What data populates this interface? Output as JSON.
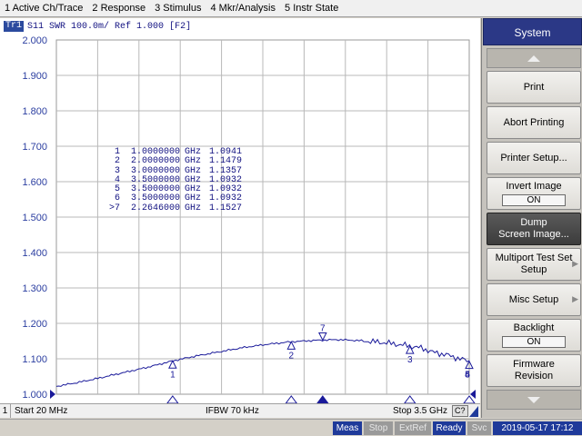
{
  "menubar": {
    "items": [
      "1 Active Ch/Trace",
      "2 Response",
      "3 Stimulus",
      "4 Mkr/Analysis",
      "5 Instr State"
    ]
  },
  "trace_header": {
    "badge": "Tr1",
    "param": "S11",
    "format": "SWR 100.0m/ Ref 1.000",
    "tag": "[F2]"
  },
  "chart_data": {
    "type": "line",
    "xlim": [
      0.02,
      3.5
    ],
    "ylim": [
      1.0,
      2.0
    ],
    "yticks": [
      "2.000",
      "1.900",
      "1.800",
      "1.700",
      "1.600",
      "1.500",
      "1.400",
      "1.300",
      "1.200",
      "1.100",
      "1.000"
    ],
    "grid": true,
    "series": [
      {
        "x": [
          0.02,
          0.2,
          0.4,
          0.6,
          0.8,
          1.0,
          1.2,
          1.4,
          1.6,
          1.8,
          2.0,
          2.2,
          2.4,
          2.6,
          2.8,
          3.0,
          3.1,
          3.2,
          3.3,
          3.4,
          3.5
        ],
        "y": [
          1.022,
          1.033,
          1.047,
          1.062,
          1.077,
          1.094,
          1.108,
          1.12,
          1.132,
          1.141,
          1.148,
          1.152,
          1.154,
          1.151,
          1.145,
          1.136,
          1.13,
          1.118,
          1.112,
          1.102,
          1.093
        ],
        "color": "#1a1a9a"
      }
    ],
    "markers": [
      {
        "label": "1",
        "num": "1",
        "freq": "1.0000000",
        "unit": "GHz",
        "value": "1.0941",
        "x": 1.0,
        "y": 1.0941
      },
      {
        "label": "2",
        "num": "2",
        "freq": "2.0000000",
        "unit": "GHz",
        "value": "1.1479",
        "x": 2.0,
        "y": 1.1479
      },
      {
        "label": "3",
        "num": "3",
        "freq": "3.0000000",
        "unit": "GHz",
        "value": "1.1357",
        "x": 3.0,
        "y": 1.1357
      },
      {
        "label": "4",
        "num": "4",
        "freq": "3.5000000",
        "unit": "GHz",
        "value": "1.0932",
        "x": 3.5,
        "y": 1.0932
      },
      {
        "label": "5",
        "num": "5",
        "freq": "3.5000000",
        "unit": "GHz",
        "value": "1.0932",
        "x": 3.5,
        "y": 1.0932
      },
      {
        "label": "6",
        "num": "6",
        "freq": "3.5000000",
        "unit": "GHz",
        "value": "1.0932",
        "x": 3.5,
        "y": 1.0932
      },
      {
        "label": "7",
        "num": ">7",
        "freq": "2.2646000",
        "unit": "GHz",
        "value": "1.1527",
        "x": 2.2646,
        "y": 1.1527,
        "active": true
      }
    ]
  },
  "chart_status": {
    "channel": "1",
    "start": "Start 20 MHz",
    "ifbw": "IFBW 70 kHz",
    "stop": "Stop 3.5 GHz",
    "cq": "C?"
  },
  "global_status": {
    "meas": "Meas",
    "stop": "Stop",
    "extref": "ExtRef",
    "ready": "Ready",
    "svc": "Svc",
    "datetime": "2019-05-17 17:12"
  },
  "softkeys": {
    "title": "System",
    "print": "Print",
    "abort_printing": "Abort Printing",
    "printer_setup": "Printer Setup...",
    "invert_image": "Invert Image",
    "invert_image_state": "ON",
    "dump_line1": "Dump",
    "dump_line2": "Screen Image...",
    "multiport_line1": "Multiport Test Set",
    "multiport_line2": "Setup",
    "misc_setup": "Misc Setup",
    "backlight": "Backlight",
    "backlight_state": "ON",
    "firmware_line1": "Firmware",
    "firmware_line2": "Revision"
  }
}
